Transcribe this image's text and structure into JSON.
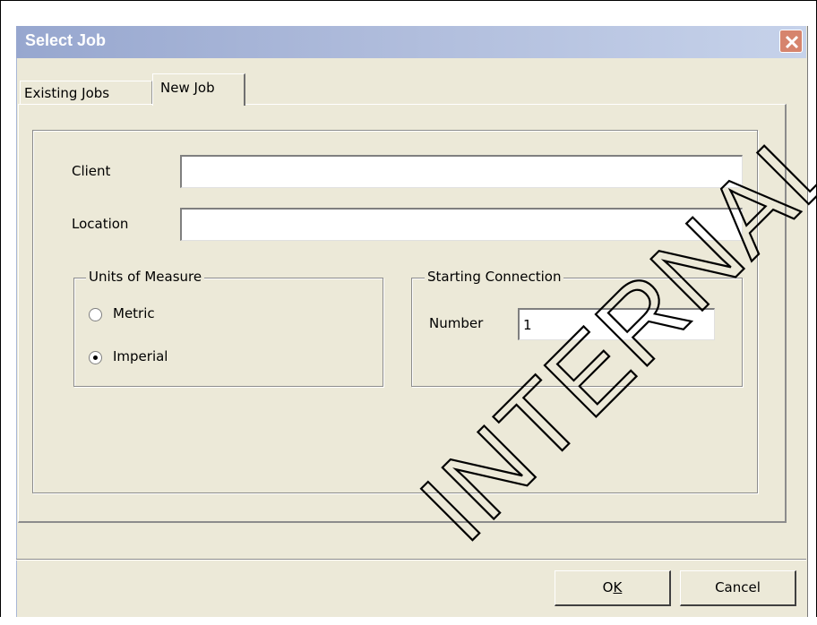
{
  "window": {
    "title": "Select Job"
  },
  "tabs": [
    {
      "label": "Existing Jobs",
      "active": false
    },
    {
      "label": "New Job",
      "active": true
    }
  ],
  "form": {
    "client_label": "Client",
    "client_value": "",
    "location_label": "Location",
    "location_value": "",
    "units_group_label": "Units of Measure",
    "units_options": [
      {
        "label": "Metric",
        "selected": false
      },
      {
        "label": "Imperial",
        "selected": true
      }
    ],
    "connection_group_label": "Starting Connection",
    "number_label": "Number",
    "number_value": "1"
  },
  "buttons": {
    "ok_prefix": "O",
    "ok_underlined": "K",
    "cancel_label": "Cancel"
  },
  "watermark": {
    "text": "INTERNAL USE"
  },
  "colors": {
    "dialog_bg": "#ece9d8",
    "titlebar_start": "#97a7cf",
    "close_button": "#d6846d"
  }
}
